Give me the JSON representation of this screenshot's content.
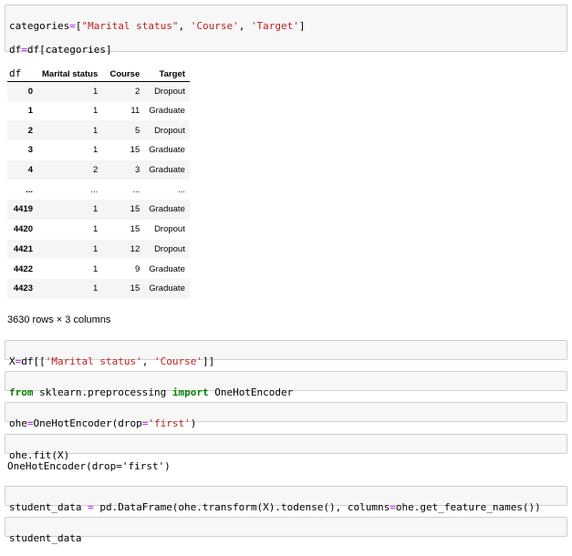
{
  "cells": {
    "c1": {
      "line1": {
        "a": "categories",
        "b": "=",
        "c": "[",
        "d": "\"Marital status\"",
        "e": ", ",
        "f": "'Course'",
        "g": ", ",
        "h": "'Target'",
        "i": "]"
      },
      "line2": {
        "a": "df",
        "b": "=",
        "c": "df[categories]"
      },
      "line3": "df"
    },
    "c2": {
      "a": "X",
      "b": "=",
      "c": "df[[",
      "d": "'Marital status'",
      "e": ", ",
      "f": "'Course'",
      "g": "]]"
    },
    "c3": {
      "a": "from",
      "b": " sklearn.preprocessing ",
      "c": "import",
      "d": " OneHotEncoder"
    },
    "c4": {
      "a": "ohe",
      "b": "=",
      "c": "OneHotEncoder(drop",
      "d": "=",
      "e": "'first'",
      "f": ")"
    },
    "c5": "ohe.fit(X)",
    "c6": {
      "a": "student_data ",
      "b": "=",
      "c": " pd.DataFrame(ohe.transform(X).todense(), columns",
      "d": "=",
      "e": "ohe.get_feature_names())"
    },
    "c7": "student_data"
  },
  "dataframe": {
    "columns": [
      "",
      "Marital status",
      "Course",
      "Target"
    ],
    "rows": [
      [
        "0",
        "1",
        "2",
        "Dropout"
      ],
      [
        "1",
        "1",
        "11",
        "Graduate"
      ],
      [
        "2",
        "1",
        "5",
        "Dropout"
      ],
      [
        "3",
        "1",
        "15",
        "Graduate"
      ],
      [
        "4",
        "2",
        "3",
        "Graduate"
      ],
      [
        "...",
        "...",
        "...",
        "..."
      ],
      [
        "4419",
        "1",
        "15",
        "Graduate"
      ],
      [
        "4420",
        "1",
        "15",
        "Dropout"
      ],
      [
        "4421",
        "1",
        "12",
        "Dropout"
      ],
      [
        "4422",
        "1",
        "9",
        "Graduate"
      ],
      [
        "4423",
        "1",
        "15",
        "Graduate"
      ]
    ],
    "shape_text": "3630 rows × 3 columns"
  },
  "fit_output": "OneHotEncoder(drop='first')",
  "syntax_colors": {
    "string": "#ba2121",
    "operator": "#aa22ff",
    "keyword": "#008000"
  }
}
